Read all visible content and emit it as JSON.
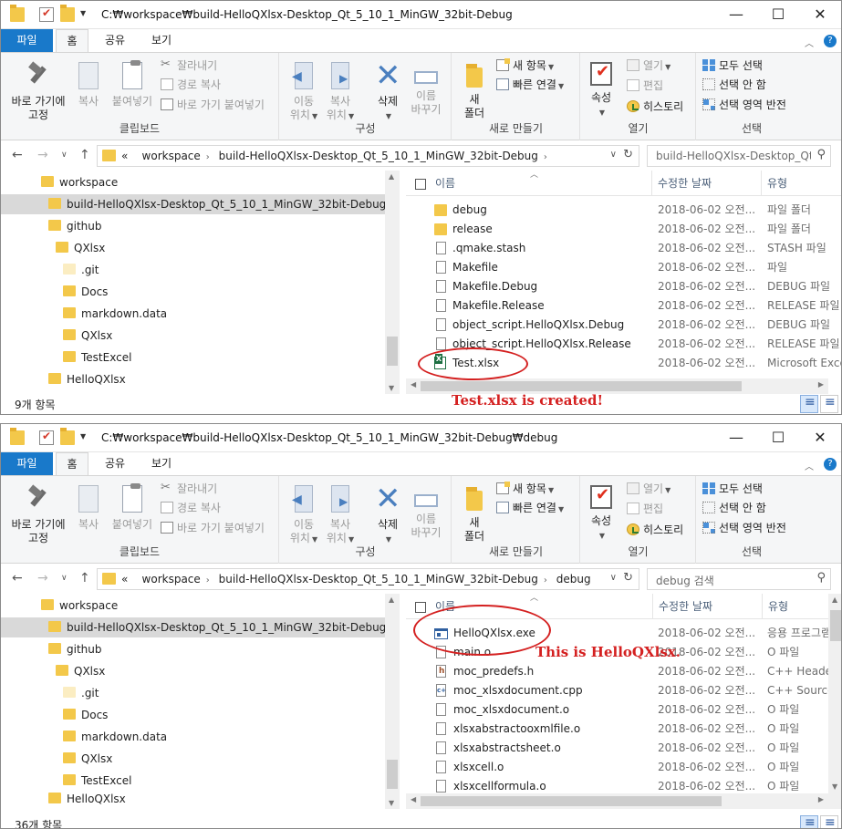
{
  "ribbon": {
    "tabs": {
      "file": "파일",
      "home": "홈",
      "share": "공유",
      "view": "보기"
    },
    "clipboard": {
      "pin_line1": "바로 가기에",
      "pin_line2": "고정",
      "copy": "복사",
      "paste": "붙여넣기",
      "cut": "잘라내기",
      "copy_path": "경로 복사",
      "paste_shortcut": "바로 가기 붙여넣기",
      "label": "클립보드"
    },
    "organize": {
      "move_line1": "이동",
      "move_line2": "위치",
      "copy_line1": "복사",
      "copy_line2": "위치",
      "delete": "삭제",
      "rename_line1": "이름",
      "rename_line2": "바꾸기",
      "label": "구성"
    },
    "new": {
      "folder_line1": "새",
      "folder_line2": "폴더",
      "new_item": "새 항목",
      "easy_access": "빠른 연결",
      "label": "새로 만들기"
    },
    "open": {
      "properties": "속성",
      "open": "열기",
      "edit": "편집",
      "history": "히스토리",
      "label": "열기"
    },
    "select": {
      "select_all": "모두 선택",
      "select_none": "선택 안 함",
      "invert": "선택 영역 반전",
      "label": "선택"
    }
  },
  "window1": {
    "title": "C:₩workspace₩build-HelloQXlsx-Desktop_Qt_5_10_1_MinGW_32bit-Debug",
    "breadcrumbs": [
      "«",
      "workspace",
      "build-HelloQXlsx-Desktop_Qt_5_10_1_MinGW_32bit-Debug"
    ],
    "search_placeholder": "build-HelloQXlsx-Desktop_Qt...",
    "tree": [
      "workspace",
      "build-HelloQXlsx-Desktop_Qt_5_10_1_MinGW_32bit-Debug",
      "github",
      "QXlsx",
      ".git",
      "Docs",
      "markdown.data",
      "QXlsx",
      "TestExcel",
      "HelloQXlsx"
    ],
    "columns": {
      "name": "이름",
      "date": "수정한 날짜",
      "type": "유형"
    },
    "files": [
      {
        "name": "debug",
        "date": "2018-06-02 오전...",
        "type": "파일 폴더",
        "icon": "folder-icon"
      },
      {
        "name": "release",
        "date": "2018-06-02 오전...",
        "type": "파일 폴더",
        "icon": "folder-icon"
      },
      {
        "name": ".qmake.stash",
        "date": "2018-06-02 오전...",
        "type": "STASH 파일",
        "icon": "file-icon"
      },
      {
        "name": "Makefile",
        "date": "2018-06-02 오전...",
        "type": "파일",
        "icon": "file-icon"
      },
      {
        "name": "Makefile.Debug",
        "date": "2018-06-02 오전...",
        "type": "DEBUG 파일",
        "icon": "file-icon"
      },
      {
        "name": "Makefile.Release",
        "date": "2018-06-02 오전...",
        "type": "RELEASE 파일",
        "icon": "file-icon"
      },
      {
        "name": "object_script.HelloQXlsx.Debug",
        "date": "2018-06-02 오전...",
        "type": "DEBUG 파일",
        "icon": "file-icon"
      },
      {
        "name": "object_script.HelloQXlsx.Release",
        "date": "2018-06-02 오전...",
        "type": "RELEASE 파일",
        "icon": "file-icon"
      },
      {
        "name": "Test.xlsx",
        "date": "2018-06-02 오전...",
        "type": "Microsoft Excel",
        "icon": "excel-icon"
      }
    ],
    "status": "9개 항목",
    "annotation": "Test.xlsx is created!"
  },
  "window2": {
    "title": "C:₩workspace₩build-HelloQXlsx-Desktop_Qt_5_10_1_MinGW_32bit-Debug₩debug",
    "breadcrumbs": [
      "«",
      "workspace",
      "build-HelloQXlsx-Desktop_Qt_5_10_1_MinGW_32bit-Debug",
      "debug"
    ],
    "search_placeholder": "debug 검색",
    "tree": [
      "workspace",
      "build-HelloQXlsx-Desktop_Qt_5_10_1_MinGW_32bit-Debug",
      "github",
      "QXlsx",
      ".git",
      "Docs",
      "markdown.data",
      "QXlsx",
      "TestExcel",
      "HelloQXlsx"
    ],
    "columns": {
      "name": "이름",
      "date": "수정한 날짜",
      "type": "유형"
    },
    "files": [
      {
        "name": "HelloQXlsx.exe",
        "date": "2018-06-02 오전...",
        "type": "응용 프로그램",
        "icon": "exe-icon"
      },
      {
        "name": "main.o",
        "date": "2018-06-02 오전...",
        "type": "O 파일",
        "icon": "file-icon"
      },
      {
        "name": "moc_predefs.h",
        "date": "2018-06-02 오전...",
        "type": "C++ Header",
        "icon": "header-icon"
      },
      {
        "name": "moc_xlsxdocument.cpp",
        "date": "2018-06-02 오전...",
        "type": "C++ Source",
        "icon": "cpp-icon"
      },
      {
        "name": "moc_xlsxdocument.o",
        "date": "2018-06-02 오전...",
        "type": "O 파일",
        "icon": "file-icon"
      },
      {
        "name": "xlsxabstractooxmlfile.o",
        "date": "2018-06-02 오전...",
        "type": "O 파일",
        "icon": "file-icon"
      },
      {
        "name": "xlsxabstractsheet.o",
        "date": "2018-06-02 오전...",
        "type": "O 파일",
        "icon": "file-icon"
      },
      {
        "name": "xlsxcell.o",
        "date": "2018-06-02 오전...",
        "type": "O 파일",
        "icon": "file-icon"
      },
      {
        "name": "xlsxcellformula.o",
        "date": "2018-06-02 오전...",
        "type": "O 파일",
        "icon": "file-icon"
      }
    ],
    "status": "36개 항목",
    "annotation": "This is HelloQXlsx."
  },
  "colors": {
    "accent": "#1979ca",
    "annotation": "#d42020",
    "folder": "#f3c84a",
    "selection": "#d9d9d9"
  }
}
